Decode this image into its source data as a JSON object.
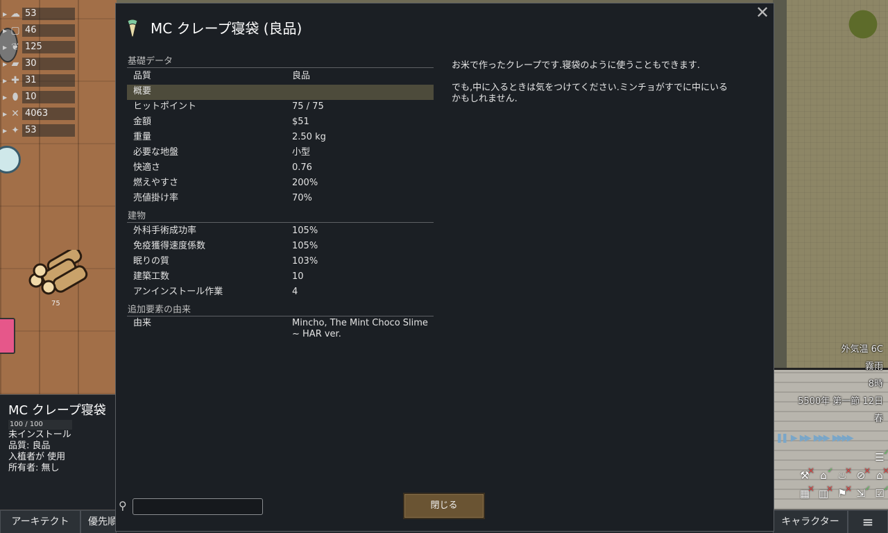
{
  "resources": [
    {
      "icon": "cloud-icon",
      "glyph": "☁",
      "value": "53"
    },
    {
      "icon": "stone-icon",
      "glyph": "▢",
      "value": "46"
    },
    {
      "icon": "berry-icon",
      "glyph": "❦",
      "value": "125"
    },
    {
      "icon": "wood-icon",
      "glyph": "▰",
      "value": "30"
    },
    {
      "icon": "medicine-icon",
      "glyph": "✚",
      "value": "31"
    },
    {
      "icon": "pill-icon",
      "glyph": "⬮",
      "value": "10"
    },
    {
      "icon": "silver-icon",
      "glyph": "✕",
      "value": "4063"
    },
    {
      "icon": "gem-icon",
      "glyph": "✦",
      "value": "53"
    }
  ],
  "map": {
    "log_stack_count": "75"
  },
  "dialog": {
    "title": "MC クレープ寝袋 (良品)",
    "close_glyph": "✕",
    "categories": [
      {
        "name": "基礎データ",
        "rows": [
          {
            "label": "品質",
            "value": "良品",
            "highlight": false
          },
          {
            "label": "概要",
            "value": "",
            "highlight": true
          },
          {
            "label": "ヒットポイント",
            "value": "75 / 75",
            "highlight": false
          },
          {
            "label": "金額",
            "value": "$51",
            "highlight": false
          },
          {
            "label": "重量",
            "value": "2.50 kg",
            "highlight": false
          },
          {
            "label": "必要な地盤",
            "value": "小型",
            "highlight": false
          },
          {
            "label": "快適さ",
            "value": "0.76",
            "highlight": false
          },
          {
            "label": "燃えやすさ",
            "value": "200%",
            "highlight": false
          },
          {
            "label": "売値掛け率",
            "value": "70%",
            "highlight": false
          }
        ]
      },
      {
        "name": "建物",
        "rows": [
          {
            "label": "外科手術成功率",
            "value": "105%",
            "highlight": false
          },
          {
            "label": "免疫獲得速度係数",
            "value": "105%",
            "highlight": false
          },
          {
            "label": "眠りの質",
            "value": "103%",
            "highlight": false
          },
          {
            "label": "建築工数",
            "value": "10",
            "highlight": false
          },
          {
            "label": "アンインストール作業",
            "value": "4",
            "highlight": false
          }
        ]
      },
      {
        "name": "追加要素の由来",
        "rows": [
          {
            "label": "由来",
            "value": "Mincho, The Mint Choco Slime ~ HAR ver.",
            "highlight": false,
            "tall": true
          }
        ]
      }
    ],
    "description": [
      "お米で作ったクレープです.寝袋のように使うこともできます.",
      "でも,中に入るときは気をつけてください.ミンチョがすでに中にいるかもしれません."
    ],
    "search": {
      "value": "",
      "placeholder": ""
    },
    "close_button": "閉じる"
  },
  "inspect": {
    "title": "MC クレープ寝袋",
    "hp": "100 / 100",
    "hp_fraction": 1.0,
    "lines": [
      "未インストール",
      "品質: 良品",
      "入植者が 使用",
      "所有者: 無し"
    ]
  },
  "bottom_bar": {
    "architect": "アーキテクト",
    "priority": "優先順",
    "characters": "キャラクター",
    "menu_icon": "≡"
  },
  "hud": {
    "temperature": "外気温 6C",
    "weather": "霧雨",
    "time": "8時",
    "date": "5500年 第一節 12日",
    "season": "春"
  }
}
